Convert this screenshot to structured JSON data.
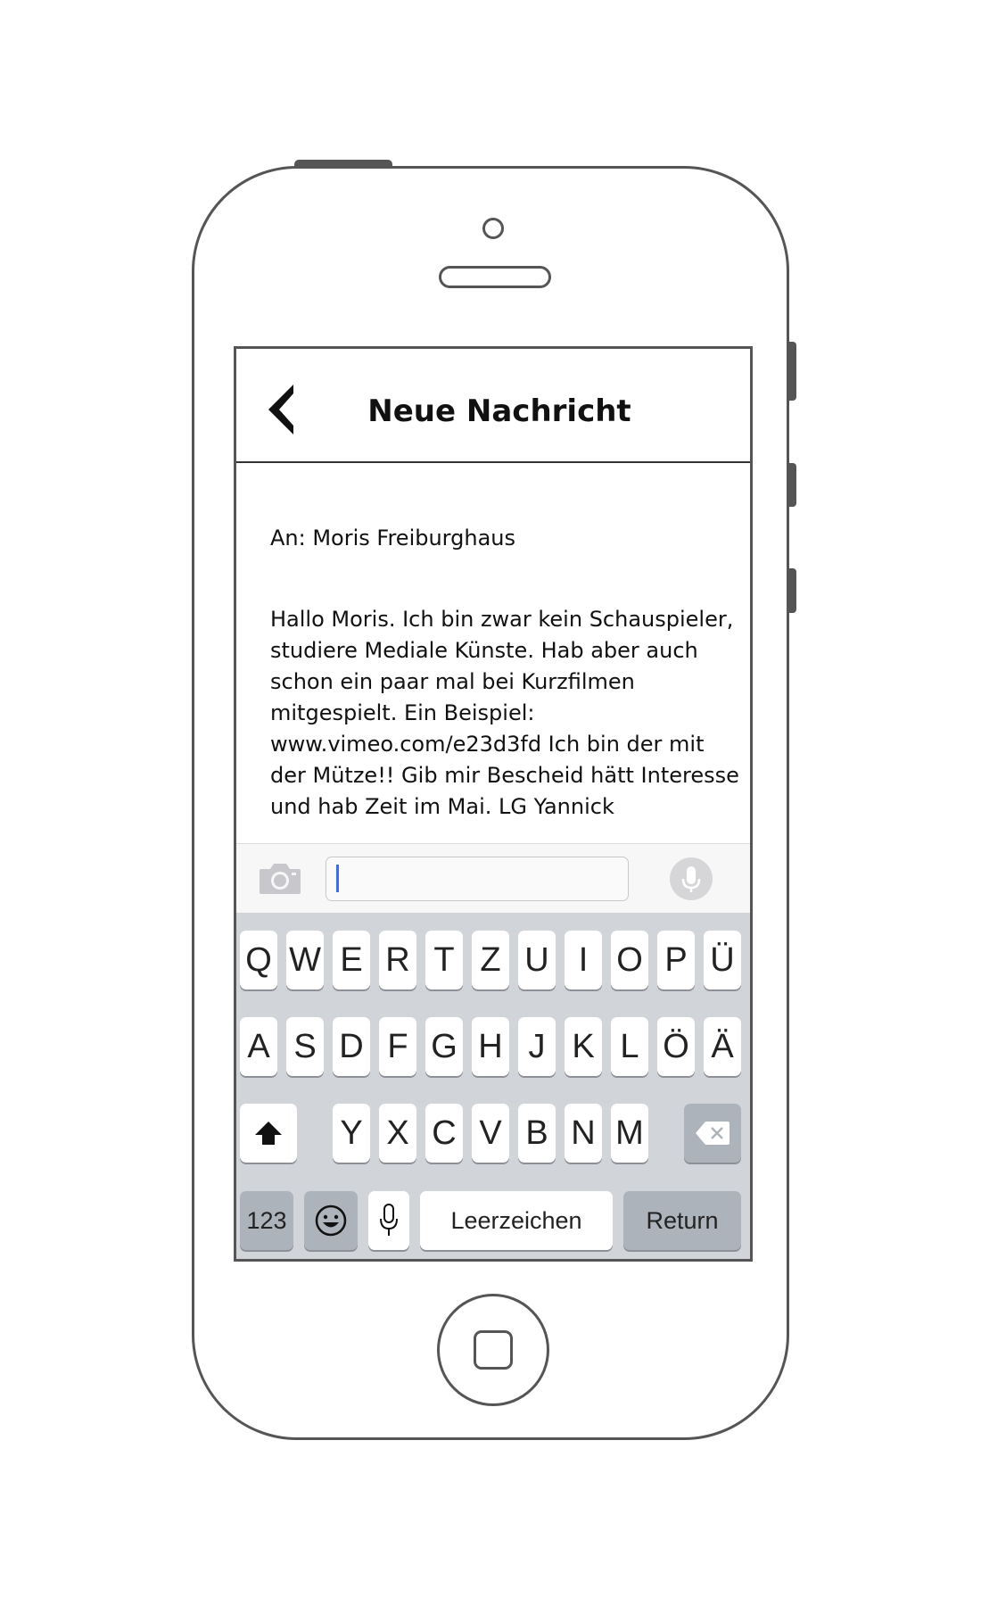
{
  "header": {
    "title": "Neue Nachricht"
  },
  "recipient": "An: Moris Freiburghaus",
  "message_lines": [
    "Hallo Moris. Ich bin zwar kein Schauspieler,",
    "studiere Mediale Künste. Hab aber auch",
    "schon ein paar mal bei Kurzfilmen",
    "mitgespielt. Ein Beispiel:",
    "www.vimeo.com/e23d3fd Ich bin der mit",
    "der Mütze!! Gib mir Bescheid hätt Interesse",
    "und hab Zeit im Mai. LG Yannick"
  ],
  "input": {
    "value": "",
    "placeholder": ""
  },
  "keyboard": {
    "row1": [
      "Q",
      "W",
      "E",
      "R",
      "T",
      "Z",
      "U",
      "I",
      "O",
      "P",
      "Ü"
    ],
    "row2": [
      "A",
      "S",
      "D",
      "F",
      "G",
      "H",
      "J",
      "K",
      "L",
      "Ö",
      "Ä"
    ],
    "row3": [
      "Y",
      "X",
      "C",
      "V",
      "B",
      "N",
      "M"
    ],
    "numbers_key": "123",
    "space_key": "Leerzeichen",
    "return_key": "Return"
  },
  "icons": {
    "back": "chevron-left-icon",
    "camera": "camera-icon",
    "dictation": "microphone-icon",
    "shift": "shift-icon",
    "delete": "backspace-icon",
    "emoji": "emoji-icon"
  },
  "colors": {
    "caret": "#3b6cf5",
    "keyboard_bg": "#d1d4d9",
    "dark_key": "#adb3bb"
  }
}
